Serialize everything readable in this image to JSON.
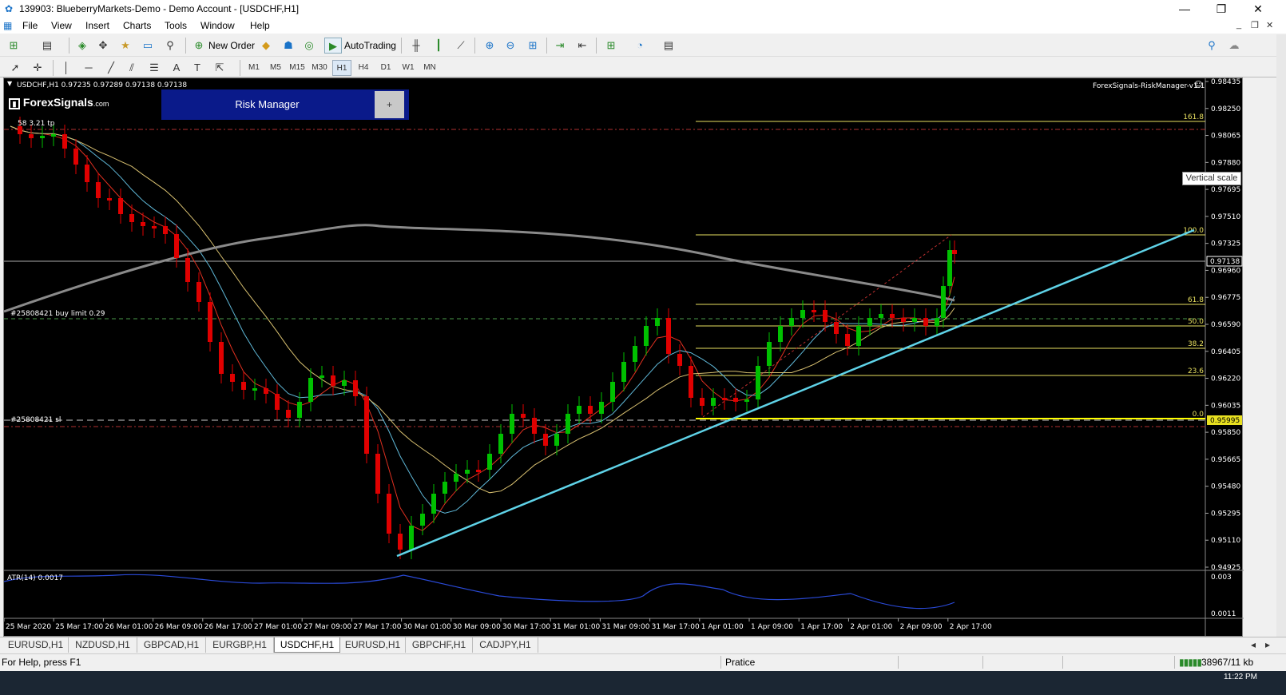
{
  "window": {
    "title": "139903: BlueberryMarkets-Demo - Demo Account - [USDCHF,H1]",
    "controls": {
      "minimize": "—",
      "restore": "❐",
      "close": "✕"
    }
  },
  "menu": {
    "items": [
      "File",
      "View",
      "Insert",
      "Charts",
      "Tools",
      "Window",
      "Help"
    ],
    "mdi": [
      "_",
      "❐",
      "✕"
    ]
  },
  "toolbar": {
    "new_order": "New Order",
    "auto_trading": "AutoTrading",
    "timeframes": [
      "M1",
      "M5",
      "M15",
      "M30",
      "H1",
      "H4",
      "D1",
      "W1",
      "MN"
    ],
    "active_timeframe": "H1"
  },
  "chart": {
    "header": "USDCHF,H1  0.97235 0.97289 0.97138 0.97138",
    "indicator_name": "ForexSignals-RiskManager-v1.1",
    "logo": "ForexSignals",
    "logo_suffix": ".com",
    "risk_manager": {
      "title": "Risk Manager",
      "button": "+"
    },
    "vertical_scale_tooltip": "Vertical scale",
    "tp_label": "58 3.21 tp",
    "buy_limit_label": "#25808421 buy limit 0.29",
    "sl_label": "#25808421 sl",
    "atr_label": "ATR(14) 0.0017",
    "price_axis": [
      "0.98435",
      "0.98250",
      "0.98065",
      "0.97880",
      "0.97695",
      "0.97510",
      "0.97325",
      "0.97138",
      "0.96960",
      "0.96775",
      "0.96590",
      "0.96405",
      "0.96220",
      "0.96035",
      "0.95995",
      "0.95850",
      "0.95665",
      "0.95480",
      "0.95295",
      "0.95110",
      "0.94925"
    ],
    "current_price": "0.97138",
    "sl_price": "0.95995",
    "atr_axis": [
      "0.003",
      "0.0011"
    ],
    "time_axis": [
      "25 Mar 2020",
      "25 Mar 17:00",
      "26 Mar 01:00",
      "26 Mar 09:00",
      "26 Mar 17:00",
      "27 Mar 01:00",
      "27 Mar 09:00",
      "27 Mar 17:00",
      "30 Mar 01:00",
      "30 Mar 09:00",
      "30 Mar 17:00",
      "31 Mar 01:00",
      "31 Mar 09:00",
      "31 Mar 17:00",
      "1 Apr 01:00",
      "1 Apr 09:00",
      "1 Apr 17:00",
      "2 Apr 01:00",
      "2 Apr 09:00",
      "2 Apr 17:00"
    ],
    "fib_levels": [
      "161.8",
      "100.0",
      "61.8",
      "50.0",
      "38.2",
      "23.6",
      "0.0"
    ],
    "colors": {
      "bull": "#00c000",
      "bear": "#e00000",
      "trendline": "#5fd3e8",
      "fib": "#e8e060",
      "ma_slow": "#8a8a8a"
    }
  },
  "tabs": [
    "EURUSD,H1",
    "NZDUSD,H1",
    "GBPCAD,H1",
    "EURGBP,H1",
    "USDCHF,H1",
    "EURUSD,H1",
    "GBPCHF,H1",
    "CADJPY,H1"
  ],
  "active_tab": "USDCHF,H1",
  "status": {
    "help": "For Help, press F1",
    "profile": "Pratice",
    "traffic": "38967/11 kb"
  },
  "taskbar": {
    "clock": "11:22 PM"
  }
}
